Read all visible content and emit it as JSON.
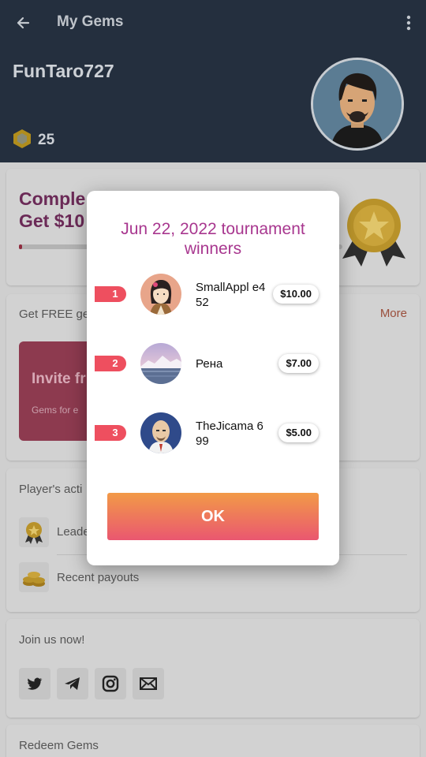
{
  "app_bar": {
    "title": "My Gems",
    "back_icon": "arrow-left-icon",
    "menu_icon": "more-vertical-icon"
  },
  "profile": {
    "username": "FunTaro727",
    "gems": "25"
  },
  "cards": {
    "complete_title_line1": "Comple",
    "complete_title_line2": "Get $10",
    "free_gems_label": "Get FREE ge",
    "more_label": "More",
    "invite_title": "Invite fr",
    "invite_sub": "Gems for e",
    "players_activity_label": "Player's acti",
    "leaderboard_label": "Leade",
    "recent_payouts_label": "Recent payouts",
    "join_label": "Join us now!",
    "redeem_label": "Redeem Gems",
    "social": [
      "twitter-icon",
      "telegram-icon",
      "instagram-icon",
      "mail-icon"
    ]
  },
  "dialog": {
    "title": "Jun 22, 2022 tournament winners",
    "ok_label": "OK",
    "accent": "#a8378f",
    "winners": [
      {
        "rank": "1",
        "name": "SmallAppl e452",
        "prize": "$10.00"
      },
      {
        "rank": "2",
        "name": "Рена",
        "prize": "$7.00"
      },
      {
        "rank": "3",
        "name": "TheJicama 699",
        "prize": "$5.00"
      }
    ]
  }
}
